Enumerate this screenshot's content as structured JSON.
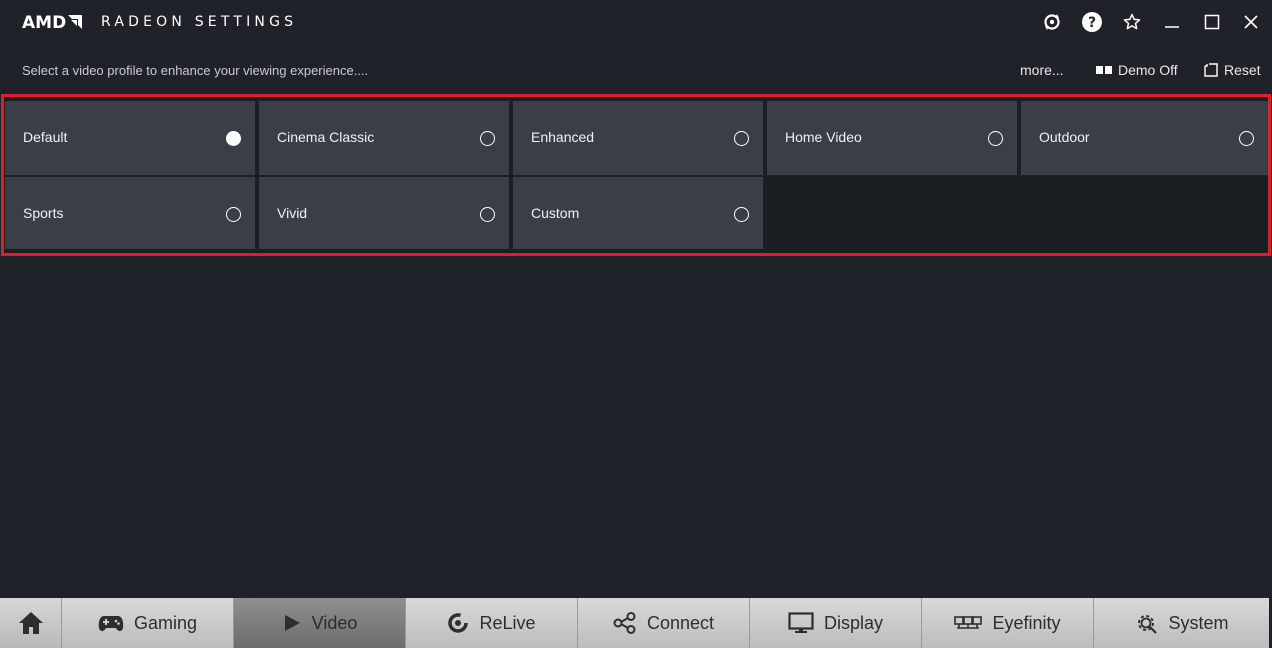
{
  "app": {
    "brand": "AMD",
    "title": "RADEON SETTINGS"
  },
  "window_controls": {
    "icons": [
      "refresh-icon",
      "help-icon",
      "star-icon",
      "minimize-icon",
      "maximize-icon",
      "close-icon"
    ]
  },
  "subbar": {
    "hint": "Select a video profile to enhance your viewing experience....",
    "more_label": "more...",
    "demo_label": "Demo Off",
    "reset_label": "Reset"
  },
  "profiles": [
    {
      "label": "Default",
      "selected": true
    },
    {
      "label": "Cinema Classic",
      "selected": false
    },
    {
      "label": "Enhanced",
      "selected": false
    },
    {
      "label": "Home Video",
      "selected": false
    },
    {
      "label": "Outdoor",
      "selected": false
    },
    {
      "label": "Sports",
      "selected": false
    },
    {
      "label": "Vivid",
      "selected": false
    },
    {
      "label": "Custom",
      "selected": false
    }
  ],
  "nav": {
    "items": [
      {
        "label": "Gaming",
        "icon": "gamepad-icon"
      },
      {
        "label": "Video",
        "icon": "play-icon",
        "active": true
      },
      {
        "label": "ReLive",
        "icon": "relive-icon"
      },
      {
        "label": "Connect",
        "icon": "connect-icon"
      },
      {
        "label": "Display",
        "icon": "monitor-icon"
      },
      {
        "label": "Eyefinity",
        "icon": "eyefinity-icon"
      },
      {
        "label": "System",
        "icon": "gear-icon"
      }
    ]
  },
  "colors": {
    "highlight_border": "#e11d2a",
    "tile_bg": "#3a3f47",
    "window_bg": "#1f2329"
  }
}
